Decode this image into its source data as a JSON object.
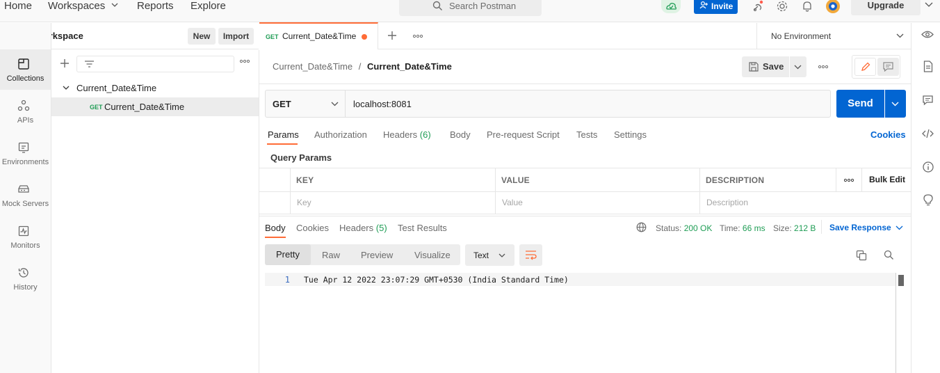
{
  "topbar": {
    "nav": [
      "Home",
      "Workspaces",
      "Reports",
      "Explore"
    ],
    "search_placeholder": "Search Postman",
    "invite_label": "Invite",
    "upgrade_label": "Upgrade"
  },
  "workspace": {
    "name": "My Workspace",
    "new_label": "New",
    "import_label": "Import"
  },
  "rail": {
    "items": [
      {
        "label": "Collections",
        "icon": "collections-icon"
      },
      {
        "label": "APIs",
        "icon": "apis-icon"
      },
      {
        "label": "Environments",
        "icon": "environments-icon"
      },
      {
        "label": "Mock Servers",
        "icon": "mock-servers-icon"
      },
      {
        "label": "Monitors",
        "icon": "monitors-icon"
      },
      {
        "label": "History",
        "icon": "history-icon"
      }
    ]
  },
  "sidebar": {
    "collection_name": "Current_Date&Time",
    "request": {
      "method": "GET",
      "name": "Current_Date&Time"
    }
  },
  "tabs": {
    "open": [
      {
        "method": "GET",
        "name": "Current_Date&Time"
      }
    ],
    "environment": "No Environment"
  },
  "request": {
    "breadcrumb_collection": "Current_Date&Time",
    "breadcrumb_separator": "/",
    "breadcrumb_request": "Current_Date&Time",
    "save_label": "Save",
    "method": "GET",
    "url": "localhost:8081",
    "send_label": "Send",
    "tabs": {
      "params": "Params",
      "authorization": "Authorization",
      "headers": "Headers",
      "headers_count": "(6)",
      "body": "Body",
      "prerequest": "Pre-request Script",
      "tests": "Tests",
      "settings": "Settings"
    },
    "cookies_link": "Cookies",
    "query_params_title": "Query Params",
    "table": {
      "columns": [
        "KEY",
        "VALUE",
        "DESCRIPTION"
      ],
      "bulk_edit": "Bulk Edit",
      "placeholders": [
        "Key",
        "Value",
        "Description"
      ]
    }
  },
  "response": {
    "tabs": {
      "body": "Body",
      "cookies": "Cookies",
      "headers": "Headers",
      "headers_count": "(5)",
      "test_results": "Test Results"
    },
    "status_label": "Status:",
    "status_value": "200 OK",
    "time_label": "Time:",
    "time_value": "66 ms",
    "size_label": "Size:",
    "size_value": "212 B",
    "save_response": "Save Response",
    "view_modes": [
      "Pretty",
      "Raw",
      "Preview",
      "Visualize"
    ],
    "format": "Text",
    "lines": [
      {
        "num": "1",
        "text": "Tue Apr 12 2022 23:07:29 GMT+0530 (India Standard Time)"
      }
    ]
  },
  "colors": {
    "accent_orange": "#ff6c37",
    "send_blue": "#0265d2",
    "status_green": "#1f9d55"
  }
}
